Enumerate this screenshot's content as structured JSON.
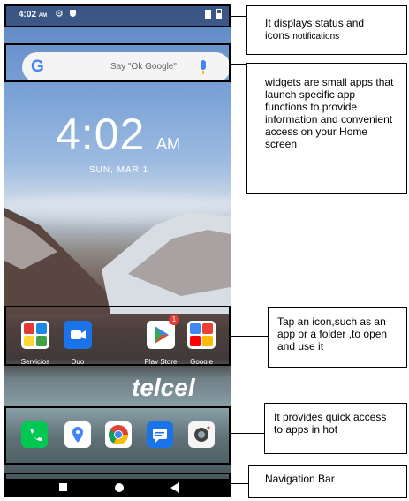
{
  "status_bar": {
    "time": "4:02",
    "ampm": "AM"
  },
  "search": {
    "hint": "Say \"Ok Google\"",
    "logo": "G"
  },
  "clock_widget": {
    "time": "4:02",
    "ampm": "AM",
    "date": "SUN, MAR 1"
  },
  "apps": [
    {
      "label": "Servicios"
    },
    {
      "label": "Duo"
    },
    {
      "label": "Play Store",
      "badge": "1"
    },
    {
      "label": "Google"
    }
  ],
  "carrier": "telcel",
  "dock": [
    {
      "icon": "phone-icon"
    },
    {
      "icon": "maps-icon"
    },
    {
      "icon": "chrome-icon"
    },
    {
      "icon": "messages-icon"
    },
    {
      "icon": "camera-icon"
    }
  ],
  "callouts": {
    "status": {
      "line1": "It displays status and",
      "line2": "icons",
      "line2_small": "notifications"
    },
    "widgets": "widgets are small apps that launch specific app functions to provide information and convenient access on your Home screen",
    "apps": "Tap an icon,such as an app or a folder ,to open and use it",
    "dock": "It provides quick access to apps in hot",
    "nav": "Navigation Bar"
  },
  "colors": {
    "accent_blue": "#4285f4",
    "highlight_border": "#000000"
  }
}
